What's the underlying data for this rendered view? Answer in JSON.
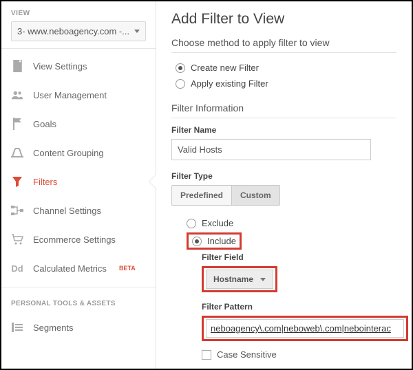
{
  "sidebar": {
    "view_label": "VIEW",
    "view_selected": "3- www.neboagency.com -...",
    "items": [
      {
        "label": "View Settings"
      },
      {
        "label": "User Management"
      },
      {
        "label": "Goals"
      },
      {
        "label": "Content Grouping"
      },
      {
        "label": "Filters"
      },
      {
        "label": "Channel Settings"
      },
      {
        "label": "Ecommerce Settings"
      },
      {
        "label": "Calculated Metrics",
        "beta": "BETA"
      }
    ],
    "section_head": "PERSONAL TOOLS & ASSETS",
    "segments_label": "Segments"
  },
  "main": {
    "title": "Add Filter to View",
    "method_head": "Choose method to apply filter to view",
    "method_options": {
      "create": "Create new Filter",
      "apply": "Apply existing Filter"
    },
    "filter_info_head": "Filter Information",
    "filter_name_label": "Filter Name",
    "filter_name_value": "Valid Hosts",
    "filter_type_label": "Filter Type",
    "type_predefined": "Predefined",
    "type_custom": "Custom",
    "exclude_label": "Exclude",
    "include_label": "Include",
    "filter_field_label": "Filter Field",
    "filter_field_value": "Hostname",
    "filter_pattern_label": "Filter Pattern",
    "filter_pattern_value": "neboagency\\.com|neboweb\\.com|nebointerac",
    "case_sensitive_label": "Case Sensitive"
  }
}
